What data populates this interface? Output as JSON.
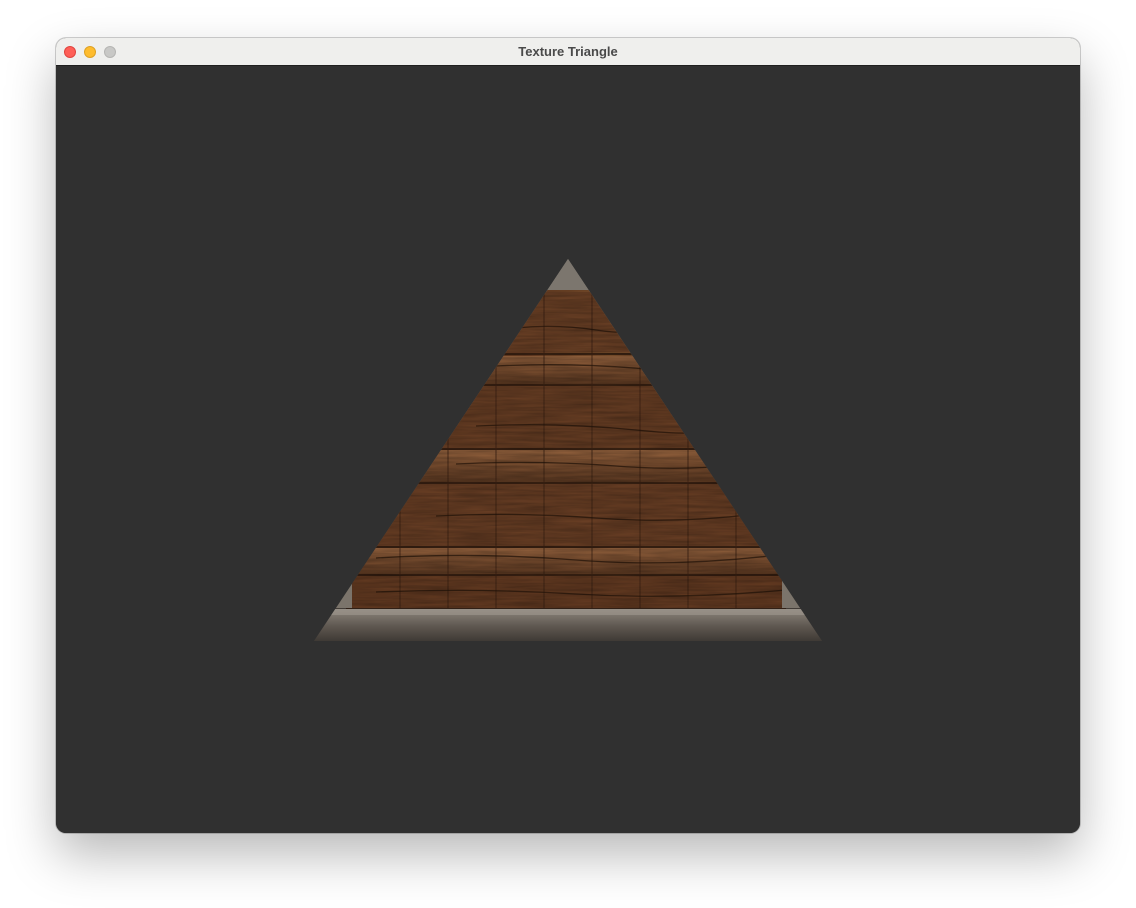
{
  "window": {
    "title": "Texture Triangle",
    "controls": [
      "close",
      "minimize",
      "zoom"
    ]
  },
  "colors": {
    "background": "#303030",
    "close": "#fe5f57",
    "minimize": "#febc2e",
    "zoom": "#c8c8c6",
    "wood_dark": "#4a2a17",
    "wood_mid": "#7a4a2c",
    "wood_light": "#9a6640",
    "stone": "#6b635b"
  },
  "scene": {
    "object": "textured-triangle",
    "texture": "wooden-crate"
  }
}
